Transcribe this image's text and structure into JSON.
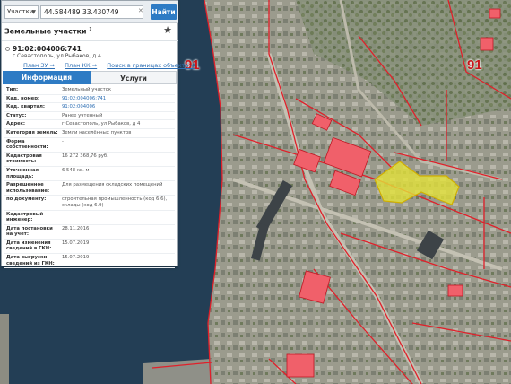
{
  "search": {
    "type_label": "Участки",
    "value": "44.584489 33.430749",
    "find_label": "Найти"
  },
  "layer": {
    "title": "Земельные участки",
    "count_sup": "1"
  },
  "parcel": {
    "number": "91:02:004006:741",
    "address": "г Севастополь, ул Рыбаков, д 4",
    "links": [
      "План ЗУ ⇒",
      "План КК ⇒",
      "Поиск в границах объекта ⇒"
    ]
  },
  "tabs": [
    "Информация",
    "Услуги"
  ],
  "attributes": [
    {
      "k": "Тип:",
      "v": "Земельный участок"
    },
    {
      "k": "Кад. номер:",
      "v": "91:02:004006:741"
    },
    {
      "k": "Кад. квартал:",
      "v": "91:02:004006"
    },
    {
      "k": "Статус:",
      "v": "Ранее учтенный"
    },
    {
      "k": "Адрес:",
      "v": "г Севастополь, ул Рыбаков, д 4"
    },
    {
      "k": "Категория земель:",
      "v": "Земли населённых пунктов"
    },
    {
      "k": "Форма собственности:",
      "v": "-"
    },
    {
      "k": "Кадастровая стоимость:",
      "v": "16 272 368,76 руб."
    },
    {
      "k": "Уточненная площадь:",
      "v": "6 548 кв. м"
    },
    {
      "k": "Разрешенное использование:",
      "v": "Для размещения складских помещений"
    },
    {
      "k": "по документу:",
      "v": "строительная промышленность (код 6.6), склады (код 6.9)"
    },
    {
      "k": "Кадастровый инженер:",
      "v": "-"
    },
    {
      "k": "Дата постановки на учет:",
      "v": "28.11.2016"
    },
    {
      "k": "Дата изменения сведений в ГКН:",
      "v": "15.07.2019"
    },
    {
      "k": "Дата выгрузки сведений из ГКН:",
      "v": "15.07.2019"
    }
  ],
  "map_labels": {
    "quarter_a": "91",
    "quarter_b": "91"
  },
  "colors": {
    "accent": "#2e7bc4",
    "boundary": "#e0202a",
    "selected": "#e4e23a",
    "building": "#f0606a"
  }
}
